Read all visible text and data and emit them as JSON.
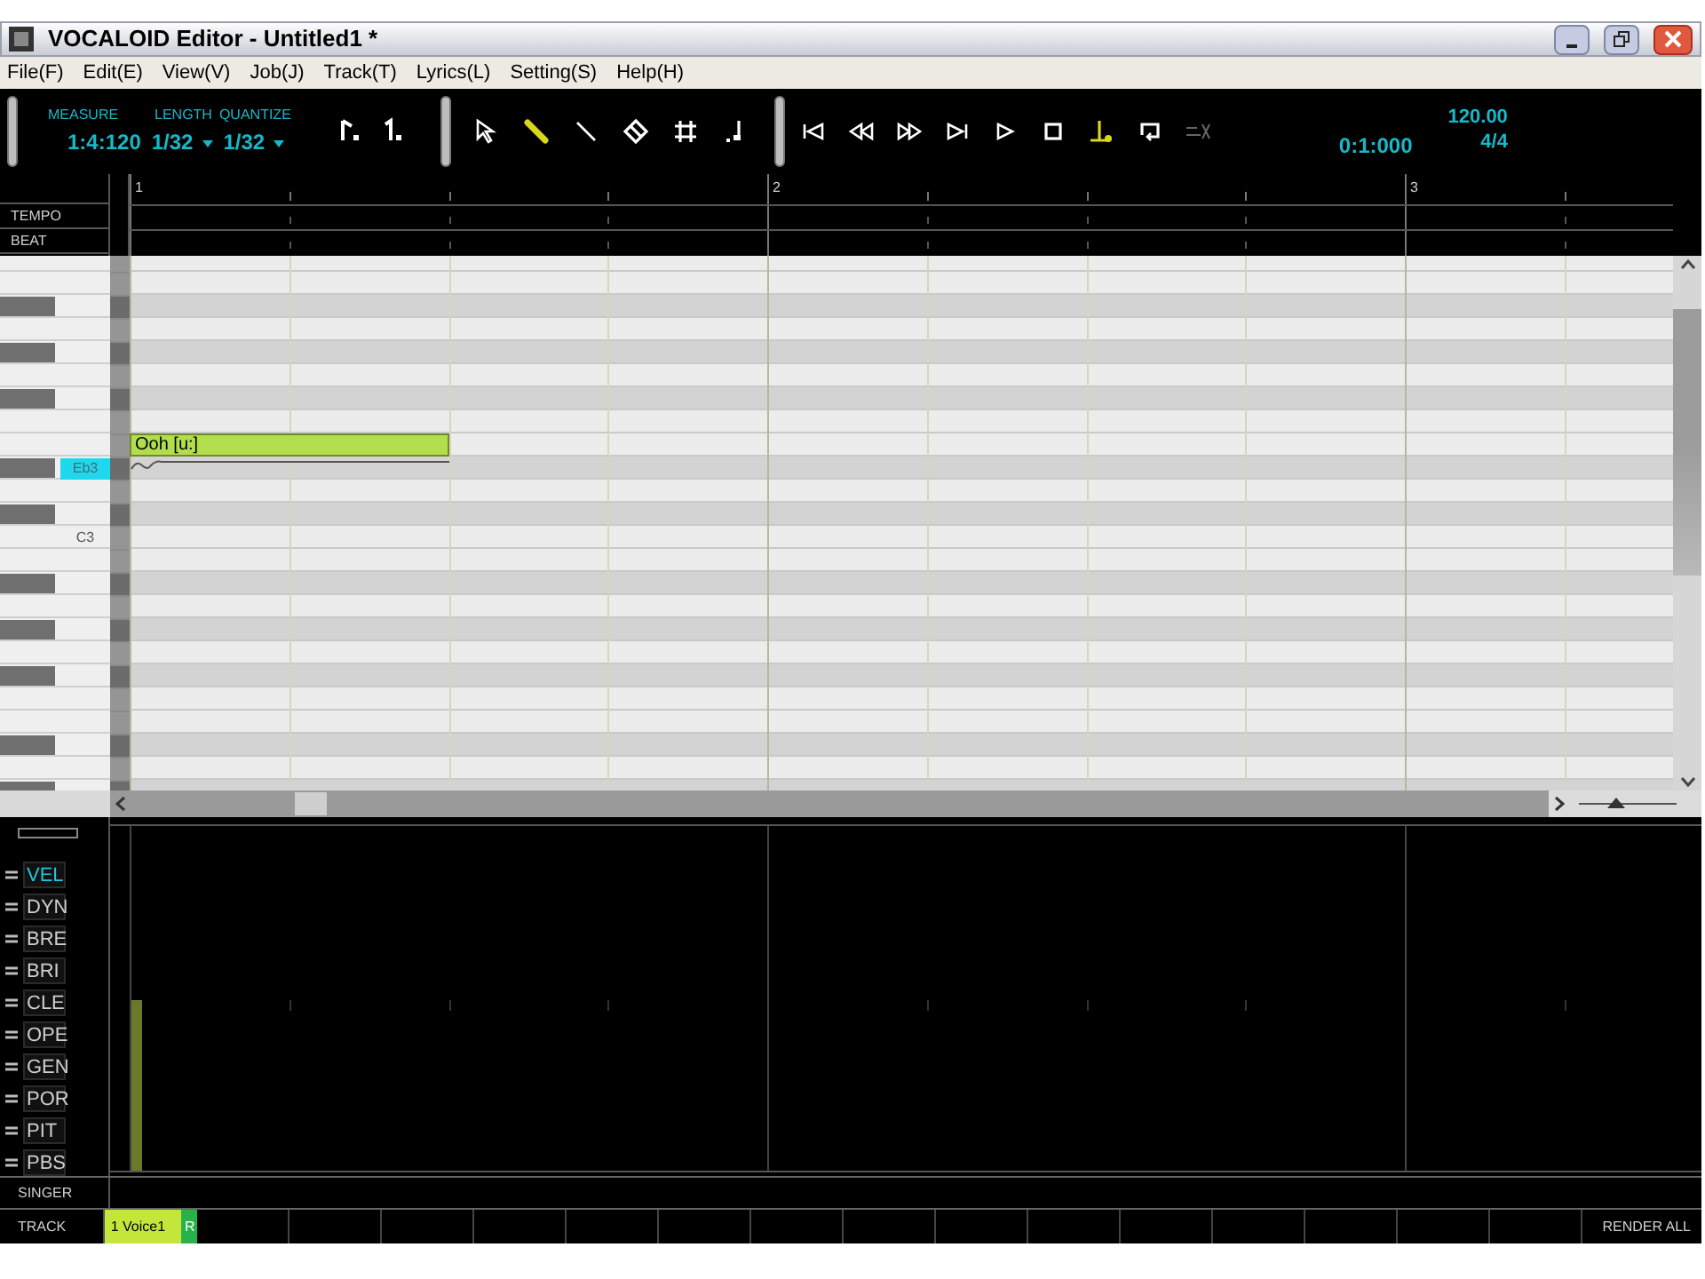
{
  "window": {
    "title": "VOCALOID Editor - Untitled1 *"
  },
  "menu": [
    "File(F)",
    "Edit(E)",
    "View(V)",
    "Job(J)",
    "Track(T)",
    "Lyrics(L)",
    "Setting(S)",
    "Help(H)"
  ],
  "toolbar": {
    "measure_label": "MEASURE",
    "measure_value": "1:4:120",
    "length_label": "LENGTH",
    "length_value": "1/32",
    "quantize_label": "QUANTIZE",
    "quantize_value": "1/32",
    "note_tools": [
      {
        "kind": "length"
      },
      {
        "kind": "quantize"
      }
    ],
    "tools": [
      {
        "kind": "arrow",
        "selected": false
      },
      {
        "kind": "pencil",
        "selected": true
      },
      {
        "kind": "line",
        "selected": false
      },
      {
        "kind": "eraser",
        "selected": false
      },
      {
        "kind": "grid",
        "selected": false
      },
      {
        "kind": "note",
        "selected": false
      }
    ],
    "transport": [
      {
        "kind": "start",
        "on": false
      },
      {
        "kind": "rewind",
        "on": false
      },
      {
        "kind": "forward",
        "on": false
      },
      {
        "kind": "end",
        "on": false
      },
      {
        "kind": "play",
        "on": false
      },
      {
        "kind": "stop",
        "on": false
      },
      {
        "kind": "follow",
        "on": true
      },
      {
        "kind": "loop",
        "on": false
      },
      {
        "kind": "rex",
        "on": false
      }
    ],
    "position": "0:1:000",
    "tempo": "120.00",
    "time_signature": "4/4"
  },
  "ruler": {
    "measures": [
      "1",
      "2",
      "3"
    ],
    "rows": [
      "TEMPO",
      "BEAT"
    ]
  },
  "piano_roll": {
    "key_labels": [
      {
        "text": "Eb3",
        "selected": true
      },
      {
        "text": "C3",
        "selected": false
      }
    ],
    "notes": [
      {
        "lyric": "Ooh [u:]"
      }
    ]
  },
  "zoom": {
    "level": 0.35
  },
  "controls": [
    {
      "label": "VEL",
      "selected": true
    },
    {
      "label": "DYN",
      "selected": false
    },
    {
      "label": "BRE",
      "selected": false
    },
    {
      "label": "BRI",
      "selected": false
    },
    {
      "label": "CLE",
      "selected": false
    },
    {
      "label": "OPE",
      "selected": false
    },
    {
      "label": "GEN",
      "selected": false
    },
    {
      "label": "POR",
      "selected": false
    },
    {
      "label": "PIT",
      "selected": false
    },
    {
      "label": "PBS",
      "selected": false
    }
  ],
  "singer_label": "SINGER",
  "track": {
    "label": "TRACK",
    "tracks": [
      {
        "name": "1 Voice1",
        "selected": true,
        "render": "R"
      }
    ],
    "render_all": "RENDER ALL"
  }
}
